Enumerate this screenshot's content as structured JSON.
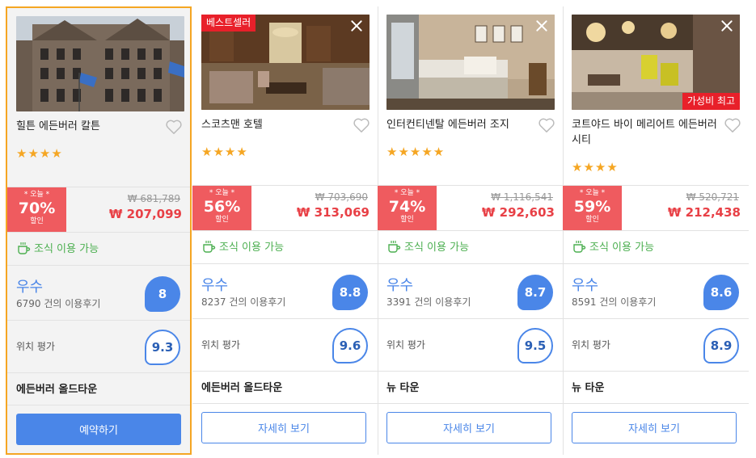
{
  "hotels": [
    {
      "name": "힐튼 에든버러 칼튼",
      "stars": "★★★★",
      "badge": "",
      "discount_today": "* 오늘 *",
      "discount_pct": "70%",
      "discount_label": "할인",
      "original_price": "₩ 681,789",
      "sale_price": "₩ 207,099",
      "breakfast": "조식 이용 가능",
      "rating_word": "우수",
      "review_count": "6790 건의 이용후기",
      "score": "8",
      "location_label": "위치 평가",
      "location_score": "9.3",
      "area": "에든버러 올드타운",
      "button": "예약하기"
    },
    {
      "name": "스코츠맨 호텔",
      "stars": "★★★★",
      "badge": "베스트셀러",
      "discount_today": "* 오늘 *",
      "discount_pct": "56%",
      "discount_label": "할인",
      "original_price": "₩ 703,690",
      "sale_price": "₩ 313,069",
      "breakfast": "조식 이용 가능",
      "rating_word": "우수",
      "review_count": "8237 건의 이용후기",
      "score": "8.8",
      "location_label": "위치 평가",
      "location_score": "9.6",
      "area": "에든버러 올드타운",
      "button": "자세히 보기"
    },
    {
      "name": "인터컨티넨탈 에든버러 조지",
      "stars": "★★★★★",
      "badge": "",
      "discount_today": "* 오늘 *",
      "discount_pct": "74%",
      "discount_label": "할인",
      "original_price": "₩ 1,116,541",
      "sale_price": "₩ 292,603",
      "breakfast": "조식 이용 가능",
      "rating_word": "우수",
      "review_count": "3391 건의 이용후기",
      "score": "8.7",
      "location_label": "위치 평가",
      "location_score": "9.5",
      "area": "뉴 타운",
      "button": "자세히 보기"
    },
    {
      "name": "코트야드 바이 메리어트 에든버러 시티",
      "stars": "★★★★",
      "badge": "가성비 최고",
      "discount_today": "* 오늘 *",
      "discount_pct": "59%",
      "discount_label": "할인",
      "original_price": "₩ 520,721",
      "sale_price": "₩ 212,438",
      "breakfast": "조식 이용 가능",
      "rating_word": "우수",
      "review_count": "8591 건의 이용후기",
      "score": "8.6",
      "location_label": "위치 평가",
      "location_score": "8.9",
      "area": "뉴 타운",
      "button": "자세히 보기"
    }
  ],
  "colors": {
    "accent": "#4a86e8",
    "discount": "#ef5b5f",
    "price": "#e84046",
    "star": "#f5a623",
    "badge": "#e8202a",
    "breakfast": "#4caf50",
    "selected_border": "#f5a623"
  },
  "icons": [
    "heart-icon",
    "close-icon",
    "coffee-cup-icon",
    "star-icon"
  ]
}
